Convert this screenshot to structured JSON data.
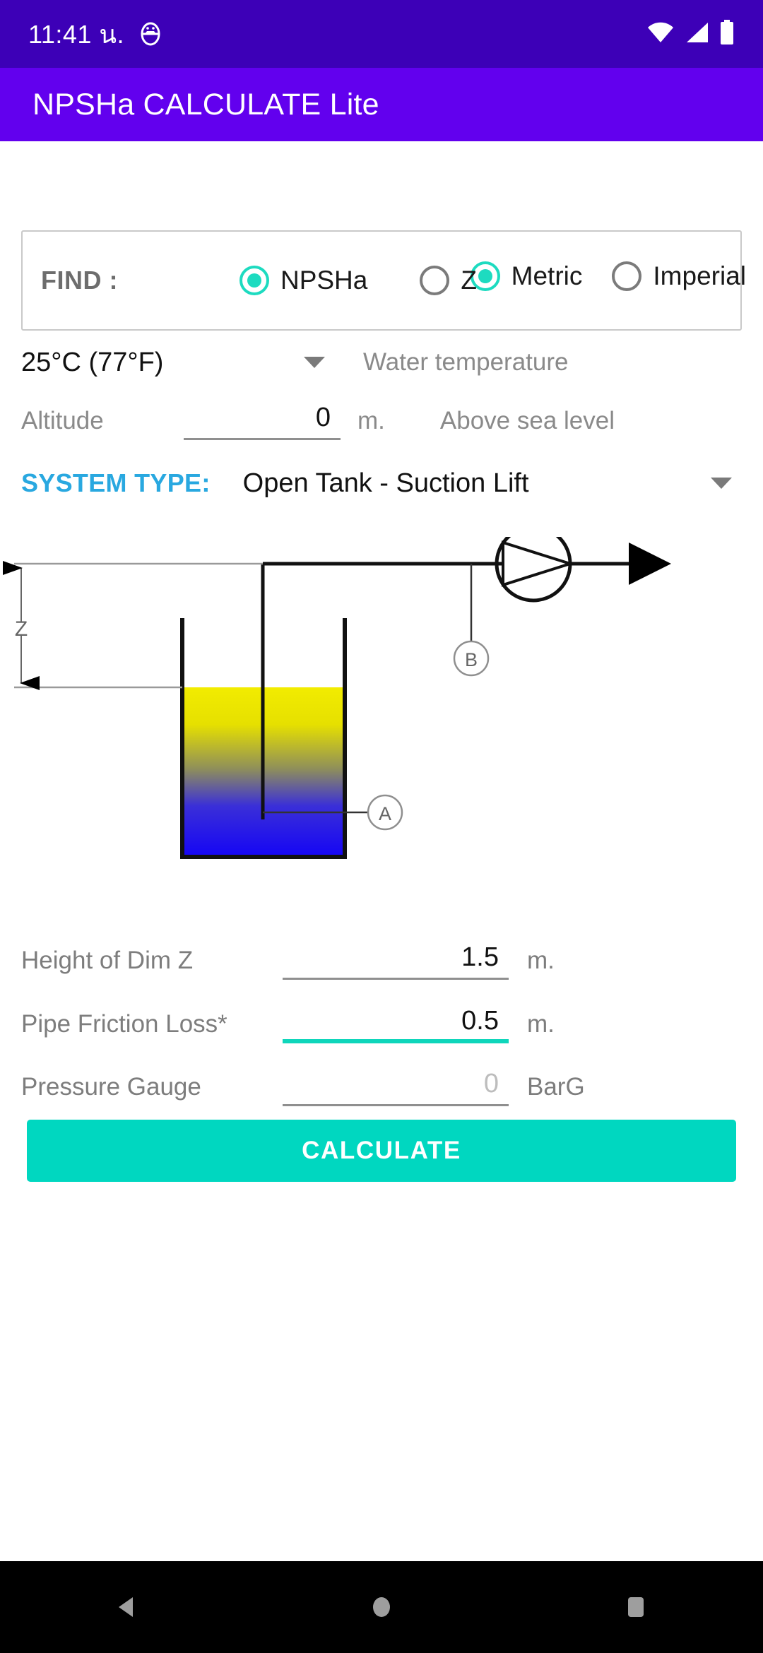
{
  "status_bar": {
    "time": "11:41 น.",
    "icons": [
      "android-debug-icon",
      "wifi-icon",
      "signal-icon",
      "battery-icon"
    ],
    "background": "#3d00b7"
  },
  "app_bar": {
    "title": "NPSHa CALCULATE Lite",
    "background": "#6200ee"
  },
  "theme": {
    "accent": "#1ddbc0",
    "button": "#00d7c0",
    "system_type_label": "#29a8e0",
    "muted_text": "#8a8a8a"
  },
  "units": {
    "options": [
      {
        "label": "Metric",
        "selected": true
      },
      {
        "label": "Imperial",
        "selected": false
      }
    ]
  },
  "find": {
    "label": "FIND :",
    "options": [
      {
        "label": "NPSHa",
        "selected": true
      },
      {
        "label": "Z",
        "selected": false
      }
    ]
  },
  "water_temperature": {
    "value": "25°C (77°F)",
    "hint": "Water temperature",
    "caret": "chevron-down-icon"
  },
  "altitude": {
    "label": "Altitude",
    "value": "0",
    "unit": "m.",
    "hint": "Above sea level"
  },
  "system_type": {
    "label": "SYSTEM TYPE:",
    "value": "Open Tank - Suction Lift",
    "caret": "chevron-down-icon"
  },
  "diagram": {
    "dimension_label": "Z",
    "tag_a": "A",
    "tag_b": "B",
    "tank_gradient_top": "#f2ec00",
    "tank_gradient_bottom": "#1505f5",
    "description": "Open tank with suction lift: tank with liquid, dip pipe, point A in tank, point B on suction line, centrifugal pump with discharge arrow"
  },
  "inputs": [
    {
      "label": "Height of Dim Z",
      "value": "1.5",
      "placeholder": "",
      "unit": "m.",
      "focused": false,
      "is_placeholder": false
    },
    {
      "label": "Pipe Friction Loss*",
      "value": "0.5",
      "placeholder": "",
      "unit": "m.",
      "focused": true,
      "is_placeholder": false
    },
    {
      "label": "Pressure Gauge",
      "value": "0",
      "placeholder": "0",
      "unit": "BarG",
      "focused": false,
      "is_placeholder": true
    }
  ],
  "calculate_button": {
    "label": "CALCULATE"
  },
  "nav_bar": {
    "buttons": [
      "back-icon",
      "home-icon",
      "recents-icon"
    ]
  }
}
